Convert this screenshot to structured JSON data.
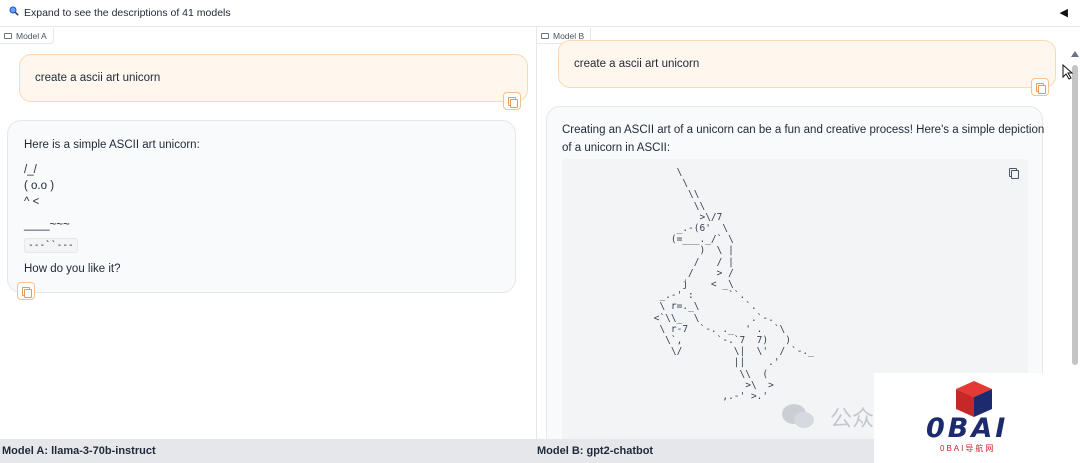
{
  "topbar": {
    "expand_label": "Expand to see the descriptions of 41 models",
    "icon": "search-icon",
    "collapse_icon": "collapse-arrow-icon"
  },
  "panel_a": {
    "tag": "Model A",
    "user_message": "create a ascii art unicorn",
    "bot_lines": {
      "intro": "Here is a simple ASCII art unicorn:",
      "l1": "/_/",
      "l2": "( o.o )",
      "l3": "^ <",
      "l4": "____~~~",
      "inline_code": "---``---",
      "outro": "How do you like it?"
    }
  },
  "panel_b": {
    "tag": "Model B",
    "user_message": "create a ascii art unicorn",
    "bot_intro_1": "Creating an ASCII art of a unicorn can be a fun and creative process! Here's a simple depiction",
    "bot_intro_2": "of a unicorn in ASCII:",
    "ascii_art": "     \\\n      \\\n       \\\\\n        \\\\\n         >\\/7\n     _.-(6'  \\\n    (=___._/` \\\n         )  \\ |\n        /   / |\n       /    > /\n      j    < _\\\n  _.-' :      ``.\n  \\ r=._\\        `.\n <`\\\\_  \\         .`-.\n  \\ r-7  `-. ._  ' .  `\\\n   \\`,      `-.`7  7)   )\n    \\/         \\|  \\'  / `-._\n               ||    .'\n                \\\\  (\n                 >\\  >\n             ,.-' >.'"
  },
  "footer": {
    "model_a": "Model A: llama-3-70b-instruct",
    "model_b": "Model B: gpt2-chatbot"
  },
  "watermark": {
    "text": "公众",
    "logo": "0BAI",
    "logo_sub": "0BAI导航网"
  },
  "colors": {
    "user_bubble_bg": "#fff7ed",
    "user_bubble_border": "#fcd9b4",
    "bot_bubble_bg": "#f9fafb",
    "footer_bg": "#e5e7eb",
    "logo_blue": "#1e2a6e",
    "logo_red": "#c0262d"
  }
}
